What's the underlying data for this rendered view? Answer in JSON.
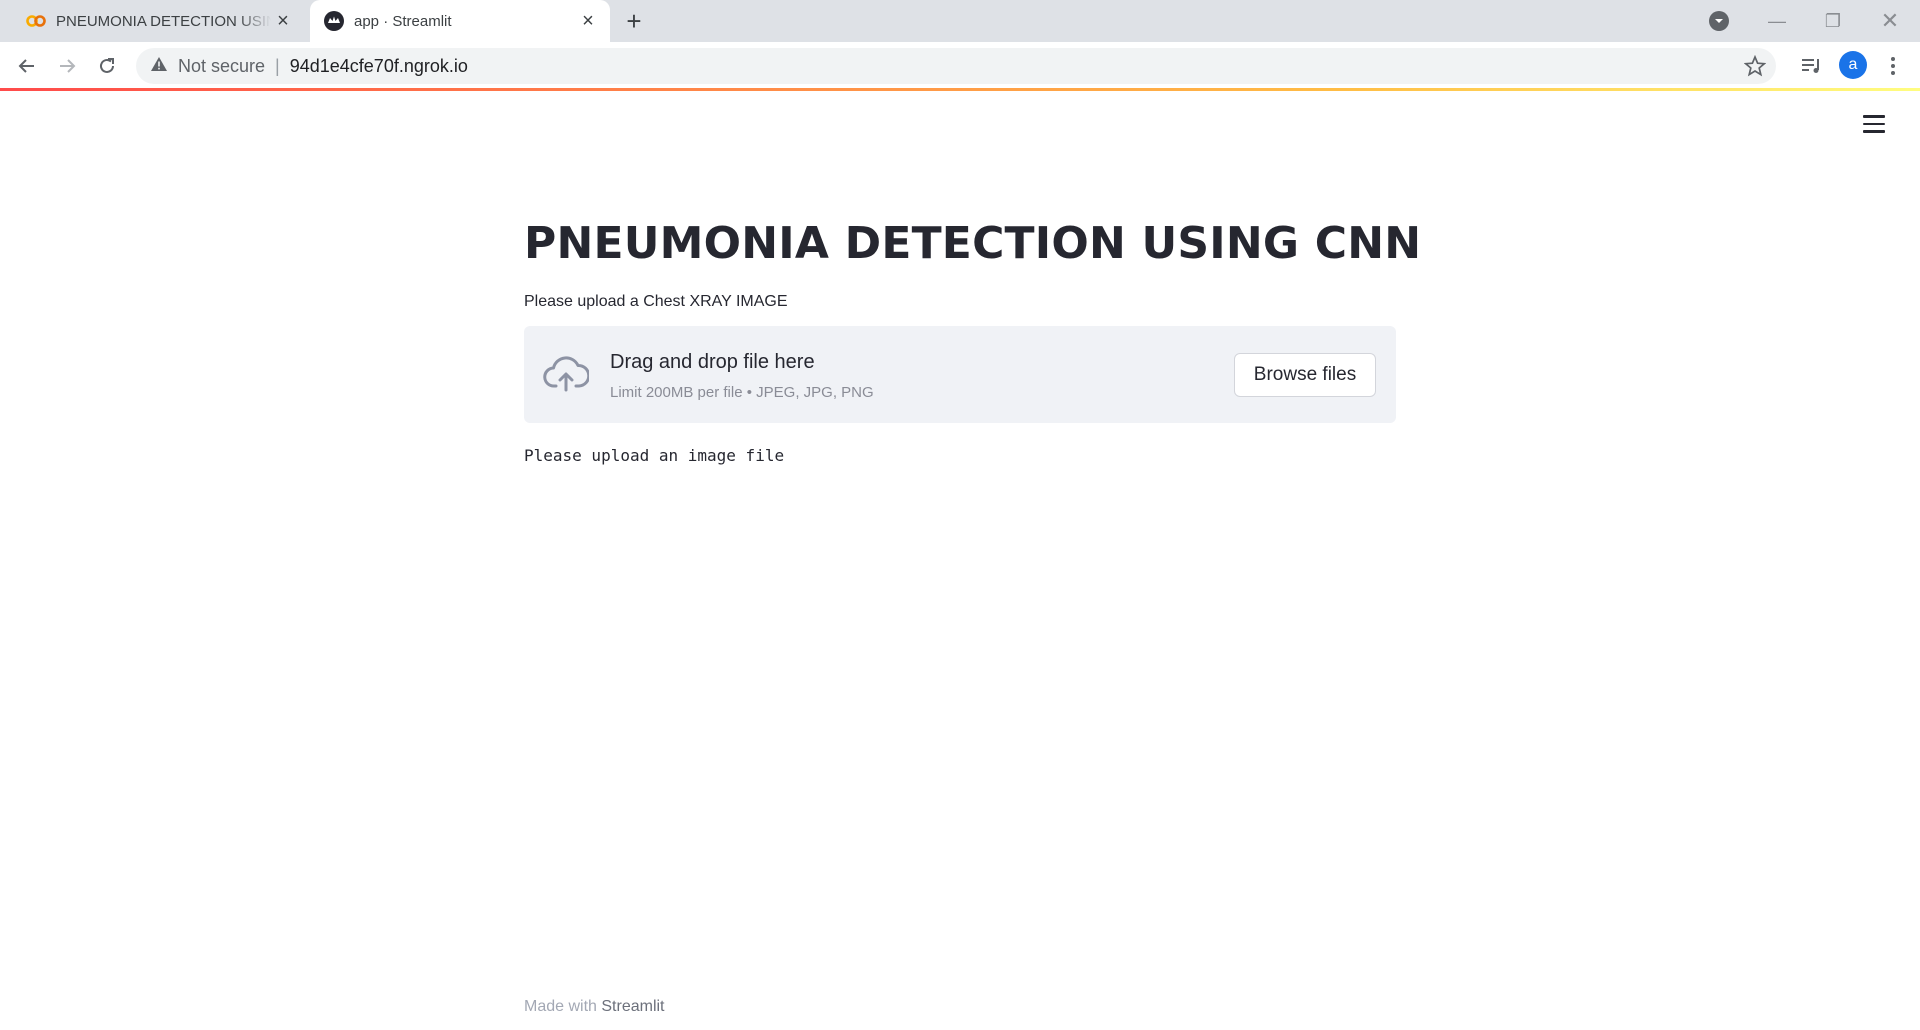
{
  "browser": {
    "tabs": [
      {
        "title": "PNEUMONIA DETECTION USING CNN",
        "favicon": "colab-icon",
        "active": false
      },
      {
        "title": "app · Streamlit",
        "favicon": "streamlit-icon",
        "active": true
      }
    ],
    "omnibox": {
      "security_label": "Not secure",
      "separator": "|",
      "url": "94d1e4cfe70f.ngrok.io"
    },
    "profile_initial": "a",
    "accent_color": "#1a73e8"
  },
  "app": {
    "title": "PNEUMONIA DETECTION USING CNN",
    "uploader": {
      "label": "Please upload a Chest XRAY IMAGE",
      "drop_text": "Drag and drop file here",
      "limit_text": "Limit 200MB per file • JPEG, JPG, PNG",
      "browse_label": "Browse files",
      "icon": "cloud-upload-icon"
    },
    "message": "Please upload an image file",
    "footer": {
      "prefix": "Made with ",
      "brand": "Streamlit"
    },
    "colors": {
      "text": "#262730",
      "dropzone_bg": "#f0f2f6",
      "decoration_start": "#ff4b4b",
      "decoration_end": "#fffd80"
    }
  }
}
